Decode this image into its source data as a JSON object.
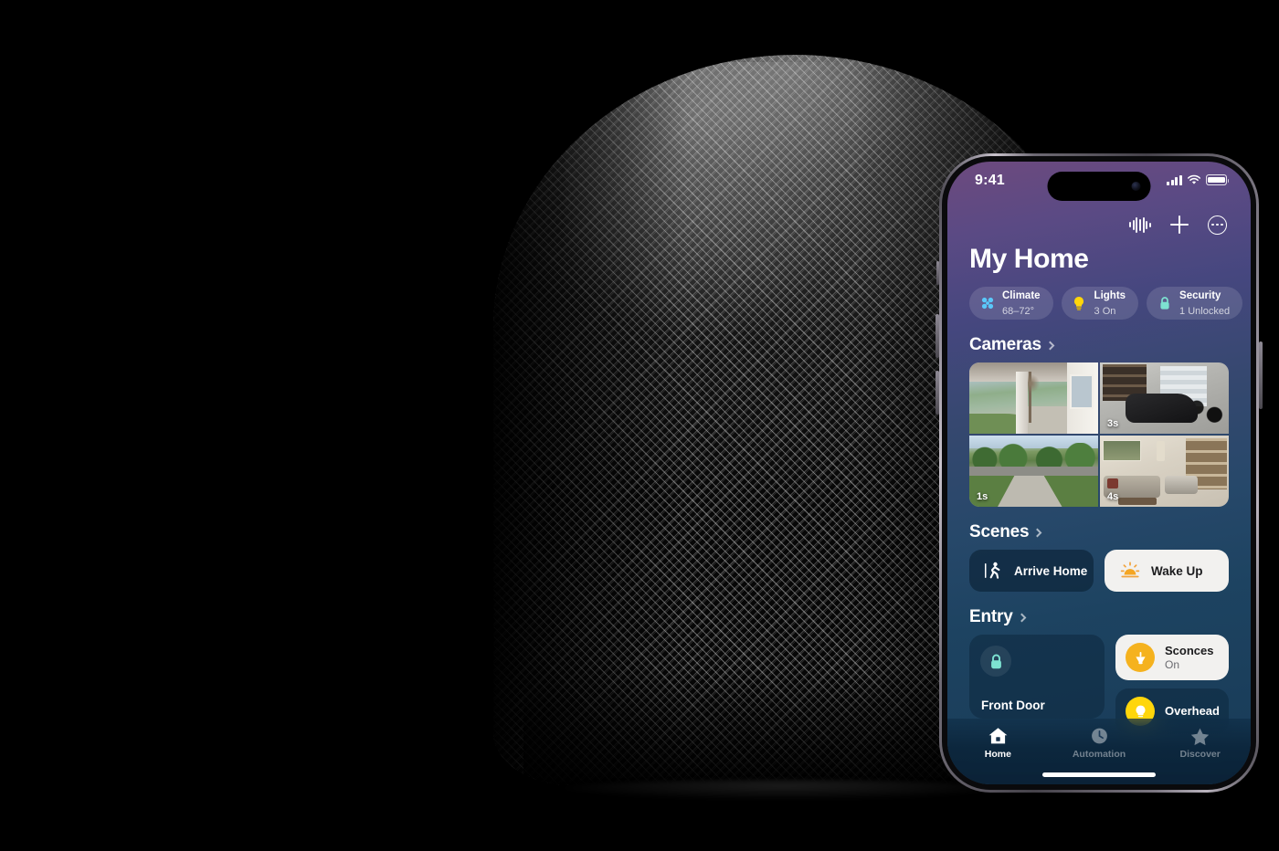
{
  "scene": {
    "background_color": "#000000",
    "product": "HomePod",
    "product_color": "midnight"
  },
  "phone": {
    "status_bar": {
      "time": "9:41",
      "cellular_icon": "signal-bars-icon",
      "wifi_icon": "wifi-icon",
      "battery_icon": "battery-icon"
    },
    "toolbar": {
      "items": [
        {
          "name": "audio-waveform-button",
          "icon": "waveform-icon"
        },
        {
          "name": "add-button",
          "icon": "plus-icon"
        },
        {
          "name": "more-options-button",
          "icon": "ellipsis-circle-icon"
        }
      ]
    },
    "header": {
      "title": "My Home"
    },
    "status_chips": [
      {
        "icon": "fan-icon",
        "icon_color": "#5ac8fa",
        "title": "Climate",
        "subtitle": "68–72°"
      },
      {
        "icon": "bulb-icon",
        "icon_color": "#ffd60a",
        "title": "Lights",
        "subtitle": "3 On"
      },
      {
        "icon": "lock-icon",
        "icon_color": "#7de2d1",
        "title": "Security",
        "subtitle": "1 Unlocked"
      }
    ],
    "sections": {
      "cameras": {
        "label": "Cameras",
        "tiles": [
          {
            "name": "camera-front-porch",
            "timestamp": ""
          },
          {
            "name": "camera-garage",
            "timestamp": "3s"
          },
          {
            "name": "camera-driveway",
            "timestamp": "1s"
          },
          {
            "name": "camera-living-room",
            "timestamp": "4s"
          }
        ]
      },
      "scenes": {
        "label": "Scenes",
        "items": [
          {
            "label": "Arrive Home",
            "icon": "walking-person-icon",
            "state": "inactive"
          },
          {
            "label": "Wake Up",
            "icon": "sunrise-icon",
            "state": "active"
          }
        ]
      },
      "entry": {
        "label": "Entry",
        "lock": {
          "label": "Front Door",
          "icon": "lock-icon",
          "icon_color": "#7de2d1"
        },
        "devices": [
          {
            "label": "Sconces",
            "state": "On",
            "icon": "sconce-lamp-icon",
            "active": true
          },
          {
            "label": "Overhead",
            "state": "",
            "icon": "bulb-icon",
            "active": false
          }
        ]
      }
    },
    "tab_bar": [
      {
        "label": "Home",
        "icon": "house-icon",
        "active": true
      },
      {
        "label": "Automation",
        "icon": "clock-icon",
        "active": false
      },
      {
        "label": "Discover",
        "icon": "star-icon",
        "active": false
      }
    ]
  }
}
